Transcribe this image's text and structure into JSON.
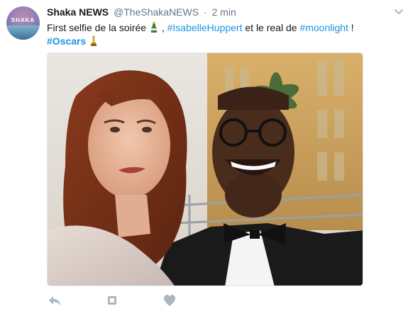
{
  "tweet": {
    "author_name": "Shaka NEWS",
    "author_handle": "@TheShakaNEWS",
    "separator": "·",
    "timestamp": "2 min",
    "avatar_logo_text": "SHAKA",
    "text_part1": "First selfie de la soirée",
    "hashtag1": "#IsabelleHuppert",
    "text_part2": " et le real de ",
    "hashtag2": "#moonlight",
    "text_part3": " !",
    "hashtag3": "#Oscars",
    "media_icon": "selfie-photo",
    "actions": {
      "reply_icon": "reply-icon",
      "retweet_icon": "retweet-icon",
      "like_icon": "heart-icon"
    }
  },
  "colors": {
    "link": "#1b95e0",
    "secondary_text": "#657786",
    "action_icon": "#aab8c2"
  }
}
